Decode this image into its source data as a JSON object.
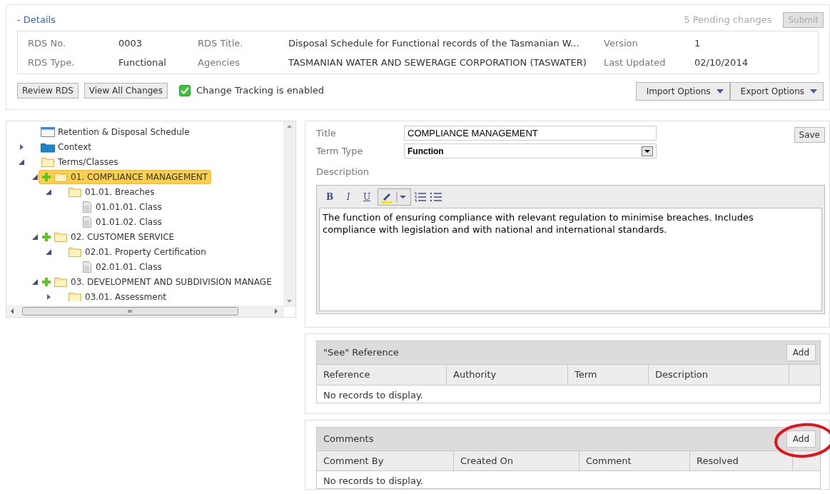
{
  "details": {
    "toggle": "- Details",
    "pending": "5 Pending changes",
    "submit": {
      "label": "Submit",
      "disabled": true
    },
    "fields": [
      {
        "label": "RDS No.",
        "value": "0003"
      },
      {
        "label": "RDS Title.",
        "value": "Disposal Schedule for Functional records of the Tasmanian W..."
      },
      {
        "label": "Version",
        "value": "1"
      },
      {
        "label": "RDS Type.",
        "value": "Functional"
      },
      {
        "label": "Agencies",
        "value": "TASMANIAN WATER AND SEWERAGE CORPORATION (TASWATER)"
      },
      {
        "label": "Last Updated",
        "value": "02/10/2014"
      }
    ],
    "buttons": [
      "Review RDS",
      "View All Changes"
    ],
    "tracking": {
      "label": "Change Tracking is enabled",
      "checked": true
    },
    "menus": [
      "Import Options",
      "Export Options"
    ]
  },
  "tree": [
    {
      "label": "Retention & Disposal Schedule",
      "kind": "schedule",
      "selected": false
    },
    {
      "label": "Context",
      "kind": "context",
      "expanded": false,
      "selected": false
    },
    {
      "label": "Terms/Classes",
      "kind": "folder",
      "expanded": true,
      "selected": false,
      "children": [
        {
          "label": "01. COMPLIANCE MANAGEMENT",
          "kind": "folder",
          "addable": true,
          "expanded": true,
          "selected": true,
          "children": [
            {
              "label": "01.01. Breaches",
              "kind": "folder",
              "expanded": true,
              "selected": false,
              "children": [
                {
                  "label": "01.01.01. Class",
                  "kind": "class",
                  "selected": false
                },
                {
                  "label": "01.01.02. Class",
                  "kind": "class",
                  "selected": false
                }
              ]
            }
          ]
        },
        {
          "label": "02. CUSTOMER SERVICE",
          "kind": "folder",
          "addable": true,
          "expanded": true,
          "selected": false,
          "children": [
            {
              "label": "02.01. Property Certification",
              "kind": "folder",
              "expanded": true,
              "selected": false,
              "children": [
                {
                  "label": "02.01.01. Class",
                  "kind": "class",
                  "selected": false
                }
              ]
            }
          ]
        },
        {
          "label": "03. DEVELOPMENT AND SUBDIVISION MANAGE",
          "kind": "folder",
          "addable": true,
          "expanded": true,
          "selected": false,
          "children": [
            {
              "label": "03.01. Assessment",
              "kind": "folder",
              "expanded": false,
              "selected": false
            }
          ]
        }
      ]
    }
  ],
  "form": {
    "title_label": "Title",
    "title_value": "COMPLIANCE MANAGEMENT",
    "save": "Save",
    "type_label": "Term Type",
    "type_value": "Function",
    "description_label": "Description",
    "toolbar": [
      {
        "kind": "bold",
        "label": "B"
      },
      {
        "kind": "italic",
        "label": "I"
      },
      {
        "kind": "underline",
        "label": "U"
      },
      {
        "kind": "highlight"
      },
      {
        "kind": "ordered-list"
      },
      {
        "kind": "bullet-list"
      }
    ],
    "description": "The function of ensuring compliance with relevant regulation to minimise breaches.  Includes compliance with legislation and with national and international standards."
  },
  "grids": [
    {
      "title": "\"See\" Reference",
      "add": {
        "label": "Add",
        "circled": false
      },
      "columns": [
        "Reference",
        "Authority",
        "Term",
        "Description"
      ],
      "empty": "No records to display."
    },
    {
      "title": "Comments",
      "add": {
        "label": "Add",
        "circled": true
      },
      "columns": [
        "Comment By",
        "Created On",
        "Comment",
        "Resolved"
      ],
      "empty": "No records to display."
    }
  ]
}
